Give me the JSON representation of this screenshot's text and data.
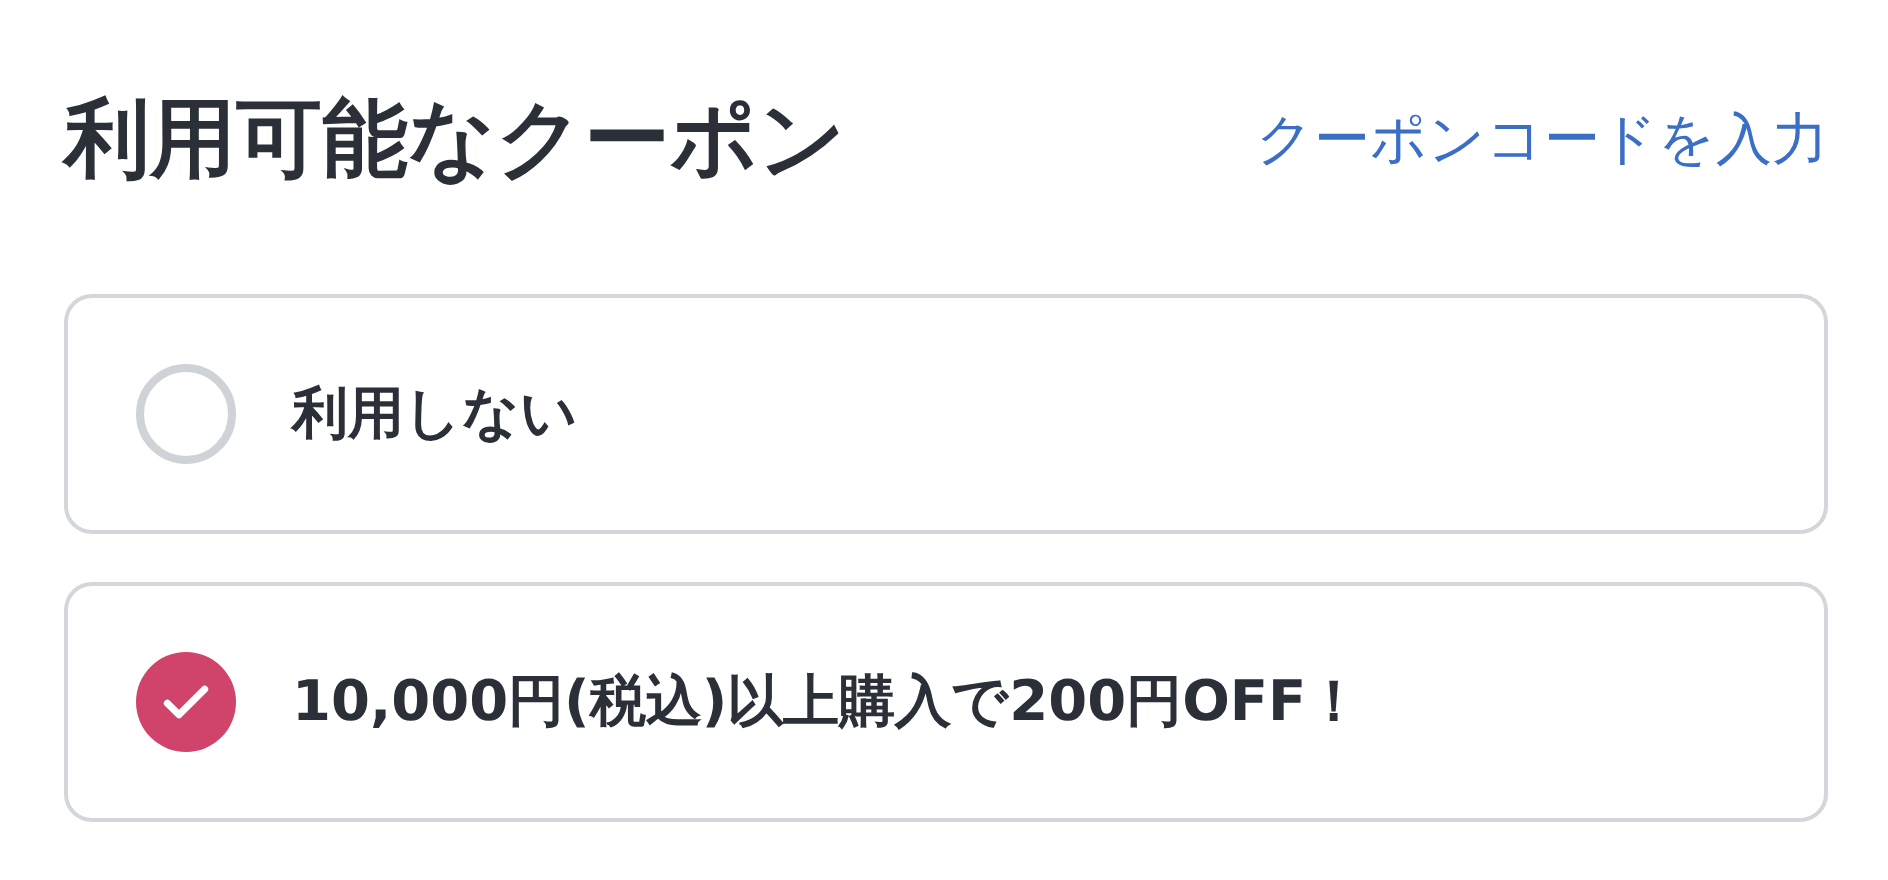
{
  "title": "利用可能なクーポン",
  "code_link": "クーポンコードを入力",
  "options": [
    {
      "label": "利用しない",
      "selected": false
    },
    {
      "label": "10,000円(税込)以上購入で200円OFF！",
      "selected": true
    }
  ]
}
